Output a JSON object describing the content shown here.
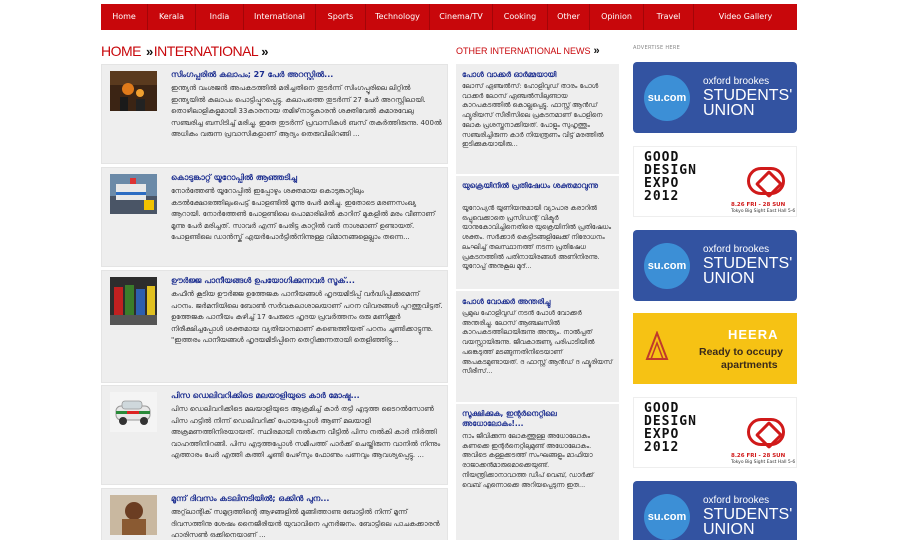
{
  "nav": {
    "items": [
      "Home",
      "Kerala",
      "India",
      "International",
      "Sports",
      "Technology",
      "Cinema/TV",
      "Cooking",
      "Other",
      "Opinion",
      "Travel",
      "Video Gallery"
    ]
  },
  "breadcrumb": {
    "home": "HOME",
    "section": "INTERNATIONAL"
  },
  "other_news": {
    "heading": "OTHER INTERNATIONAL NEWS"
  },
  "ads": {
    "label": "ADVERTISE HERE",
    "su": {
      "circle": "su.com",
      "line1": "oxford brookes",
      "line2": "STUDENTS'",
      "line3": "UNION"
    },
    "gd": {
      "title": "GOOD\nDESIGN\nEXPO\n2012",
      "date": "8.26 FRI - 28 SUN",
      "venue": "Tokyo Big Sight East Hall 5-6"
    },
    "heera": {
      "name": "HEERA",
      "tag1": "Ready to occupy",
      "tag2": "apartments"
    }
  },
  "articles": [
    {
      "title": "സിംഗപ്പൂരില്‍ കലാപം; 27 പേര്‍ അറസ്റ്റില്‍...",
      "body": "ഇന്ത്യന്‍ വംശജന്‍ അപകടത്തില്‍ മരിച്ചതിനെ തുടര്‍ന്ന് സിംഗപ്പൂരിലെ ലിറ്റില്‍ ഇന്ത്യയില്‍ കലാപം പൊട്ടിപ്പുറപ്പെട്ടു. കലാപത്തെ തുടര്‍ന്ന് 27 പേര്‍ അറസ്റ്റിലായി. തൊഴിലാളികളുമായി 33കാരനായ തമിഴ്‌നാട്ടുകാരന്‍ ശക്തിവേല്‍ കുമാരവേലു സഞ്ചരിച്ച ബസിടിച്ച് മരിച്ചു. ഇതേ തുടര്‍ന്ന് പ്രവാസികള്‍ ബസ് തകര്‍ത്തിരുന്നു. 400ല്‍ അധികം വരുന്ന പ്രവാസികളാണ് ആദ്യം തെരുവിലിറങ്ങി ..."
    },
    {
      "title": "കൊടുങ്കാറ്റ് യൂറോപ്പില്‍ ആഞ്ഞടിച്ചു",
      "body": "നോര്‍ത്തേണ്‍ യൂറോപ്പില്‍ ഇപ്പോഴും ശക്തമായ കൊടുങ്കാറ്റിലും കടല്‍ക്ഷോഭത്തിലുംപെട്ട് പോളണ്ടില്‍ മൂന്നു പേര്‍ മരിച്ചു. ഇതോടെ മരണസംഖ്യ ആറായി. നോര്‍ത്തേണ്‍ പോളണ്ടിലെ പൊമാരിലില്‍ കാറിന് മുകളില്‍ മരം വീണാണ് മൂന്നു പേര്‍ മരിച്ചത്. സാവര്‍ എന്ന് പേരിട്ട കാറ്റില്‍ വന്‍ നാശമാണ് ഉണ്ടായത്. പോളണ്ടിലെ ഡാന്‍സ്ക് എയര്‍പോര്‍ട്ടില്‍നിന്നുള്ള വിമാനങ്ങളെല്ലാം തന്നെ..."
    },
    {
      "title": "ഊര്‍ജ്ജ പാനീയങ്ങള്‍ ഉപയോഗിക്കുന്നവര്‍ സൂക്...",
      "body": "കഫീന്‍ കൂടിയ ഊര്‍ജ്ജ ഉത്തേജക പാനീയങ്ങള്‍ ഹൃദയമിടിപ്പ് വര്‍ദ്ധിപ്പിക്കുമെന്ന് പഠനം. ജര്‍മനിയിലെ ബോണ്‍ സര്‍വകലാശാലയാണ് പഠന വിവരങ്ങള്‍ പുറത്തുവിട്ടത്. ഉത്തേജക പാനീയം കഴിച്ച് 17 പേരുടെ ഹൃദയ പ്രവര്‍ത്തനം ഒരു മണിക്കൂര്‍ നിരീക്ഷിച്ചപ്പോള്‍ ശക്തമായ വ്യതിയാനമാണ് കണ്ടെത്തിയത് പഠനം ചൂണ്ടിക്കാട്ടുന്നു. \"ഇത്തരം പാനീയങ്ങള്‍ ഹൃദയമിടിപ്പിനെ തെറ്റിക്കുന്നതായി തെളിഞ്ഞിട്ടു..."
    },
    {
      "title": "പിസ ഡെലിവറിക്കിടെ മലയാളിയുടെ കാര്‍ മോഷ്ട...",
      "body": "പിസ ഡെലിവറിക്കിടെ മലയാളിയുടെ ആക്രമിച്ച് കാര്‍ തട്ടി എടുത്ത ടൈറല്‍സോണ്‍ പിസ ഹട്ടില്‍ നിന്ന് ഡെലിവറിക്ക് പോയപ്പോള്‍ ആണ് മലയാളി അക്രമണത്തിനിരയായത്. സ്ഥിരമായി നല്‍കുന്ന വീട്ടില്‍ പിസ നല്‍കി കാര്‍ നിര്‍ത്തി വാഹത്തിനിറങ്ങി. പിസ എടുത്തപ്പോള്‍ സമീപത്ത് പാര്‍ക്ക് ചെയ്തിരുന്ന വാനില്‍ നിന്നും എത്താരം പേര്‍ എത്തി കത്തി ചൂണ്ടി പേഴ്‌സും ഫോണും പണവും ആവശ്യപ്പെട്ടു. ..."
    },
    {
      "title": "മൂന്ന് ദിവസം കടലിനടിയില്‍; ഒക്കിന്‍ പുന...",
      "body": "അറ്റ്‌ലാന്റിക് സമുദ്രത്തിന്റെ ആഴങ്ങളില്‍ മുങ്ങിത്താണ്ട ബോട്ടില്‍ നിന്ന് മൂന്ന് ദിവസത്തിനു ശേഷം നൈജീരിയന്‍ യുവാവിനെ പുനര്‍ജനം. ബോട്ടിലെ പാചകക്കാരന്‍ ഹാരിസണ്‍ ഒക്കിനെയാണ് ..."
    }
  ],
  "side_news": [
    {
      "title": "പോള്‍ വാക്കര്‍ ഓര്‍മ്മയായി",
      "body": "ലോസ് ഏഞ്ചല്‍സ്: ഹോളിവുഡ് താരം പോള്‍ വാക്കര്‍ ലോസ് ഏഞ്ചല്‍സിലുണ്ടായ കാറപകടത്തില്‍ കൊല്ലപ്പെട്ടു. ഫാസ്റ്റ് ആന്‍ഡ് ഫ്യൂരിയസ് സീരീസിലെ പ്രകടനമാണ് പോളിനെ ലോക പ്രശസ്തനാക്കിയത്. പോളും സുഹൃത്തും സഞ്ചരിച്ചിരുന്ന കാര്‍ നിയന്ത്രണം വിട്ട് മരത്തില്‍ ഇടിക്കുകയായിരു..."
    },
    {
      "title": "യുക്രെയിനില്‍ പ്രതിഷേധം ശക്തമാവുന്നു",
      "body": "യൂറോപ്യന്‍ യൂണിയനുമായി വ്യാപാര കരാറില്‍ ഒപ്പുവെക്കാതെ പ്രസിഡന്റ് വിക്ടര്‍ യാനുകോവിച്ചിനെതിരെ യുക്രെയിനില്‍ പ്രതിഷേധം ശക്തം. സര്‍ക്കാര്‍ കെട്ടിടങ്ങളിലേക്ക് നിരോധനം ലംഘിച്ച് തലസ്ഥാനത്ത് നടന്ന പ്രതിഷേധ പ്രകടനത്തില്‍ പതിനായിരങ്ങള്‍ അണിനിരന്നു. യൂറോപ്പ് അനുകൂല മുദ്..."
    },
    {
      "title": "പോള്‍ വോക്കര്‍ അന്തരിച്ചു",
      "body": "പ്രമുഖ ഹോളിവുഡ് നടന്‍ പോള്‍ വോക്കര്‍ അന്തരിച്ചു. ലോസ് ആഞ്ചലസില്‍ കാറപകടത്തിലായിരുന്നു അന്ത്യം. നാല്‍പ്പത് വയസ്സായിരുന്നു. ജീവകാരുണ്യ പരിപാടിയില്‍ പങ്കെടുത്ത് മടങ്ങുന്നതിനിടെയാണ് അപകടമുണ്ടായത്. ദ ഫാസ്റ്റ് ആന്‍ഡ് ദ ഫ്യൂരിയസ് സീരീസ്..."
    },
    {
      "title": "സൂക്ഷിക്കുക, ഇന്റര്‍നെറ്റിലെ അധോലോകം!...",
      "body": "നാം ജീവിക്കുന്ന ലോകത്തുള്ള അധോലോകം കണക്കെ ഇന്റര്‍നെറ്റിലുമുണ്ട് അധോലോകം. അവിടെ കള്ളക്കടത്ത് സംഘങ്ങളും മാഫിയാ രാജാക്കന്‍മാരുമൊക്കെയുണ്ട്. നിയന്ത്രിക്കാനാവാത്ത ഡീപ് വെബ്, ഡാര്‍ക്ക് വെബ് എന്നൊക്കെ അറിയപ്പെടുന്ന ഇത..."
    }
  ]
}
